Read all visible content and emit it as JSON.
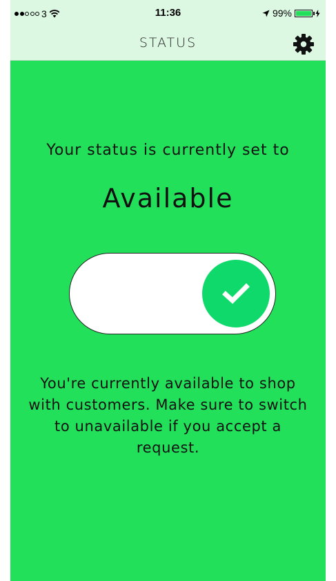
{
  "status_bar": {
    "carrier": "3",
    "signal_dots_filled": 2,
    "signal_dots_total": 5,
    "time": "11:36",
    "battery_percent": "99%",
    "battery_level": 0.99,
    "icons": [
      "wifi-icon",
      "location-arrow-icon",
      "battery-icon",
      "charging-icon"
    ]
  },
  "nav": {
    "title": "STATUS",
    "settings_icon": "gear-icon"
  },
  "main": {
    "headline": "Your status is currently set to",
    "status_value": "Available",
    "toggle_on": true,
    "toggle_icon": "checkmark-icon",
    "description": "You're currently available to shop with customers. Make sure to switch to unavailable if you accept a request."
  },
  "colors": {
    "background": "#22e05a",
    "bar": "#dcf8e3",
    "knob": "#10d96b"
  }
}
